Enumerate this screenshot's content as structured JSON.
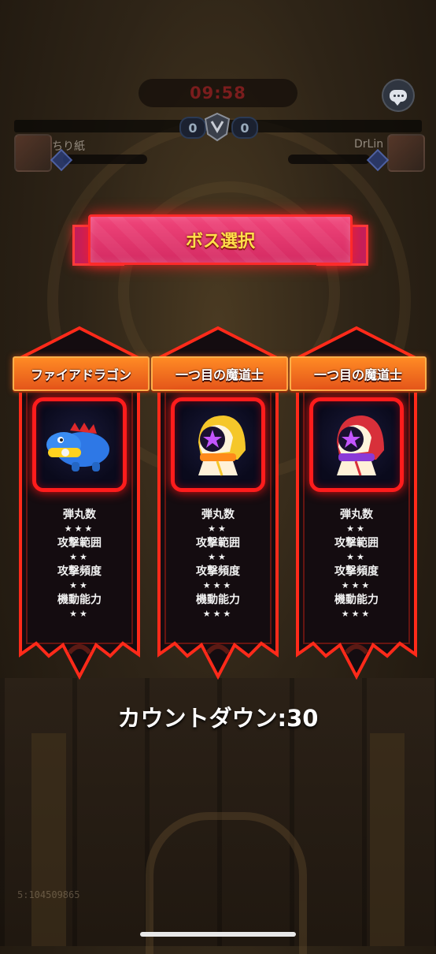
{
  "hud": {
    "timer": "09:58",
    "score_left": "0",
    "score_right": "0",
    "player_left_name": "ちり紙",
    "player_right_name": "DrLin"
  },
  "title": "ボス選択",
  "bosses": [
    {
      "name": "ファイアドラゴン",
      "icon": "blue-dragon-icon",
      "stats": [
        {
          "label": "弾丸数",
          "stars": "★★★"
        },
        {
          "label": "攻撃範囲",
          "stars": "★★"
        },
        {
          "label": "攻撃頻度",
          "stars": "★★"
        },
        {
          "label": "機動能力",
          "stars": "★★"
        }
      ]
    },
    {
      "name": "一つ目の魔道士",
      "icon": "yellow-hooded-mage-icon",
      "stats": [
        {
          "label": "弾丸数",
          "stars": "★★"
        },
        {
          "label": "攻撃範囲",
          "stars": "★★"
        },
        {
          "label": "攻撃頻度",
          "stars": "★★★"
        },
        {
          "label": "機動能力",
          "stars": "★★★"
        }
      ]
    },
    {
      "name": "一つ目の魔道士",
      "icon": "red-hooded-mage-icon",
      "stats": [
        {
          "label": "弾丸数",
          "stars": "★★"
        },
        {
          "label": "攻撃範囲",
          "stars": "★★"
        },
        {
          "label": "攻撃頻度",
          "stars": "★★★"
        },
        {
          "label": "機動能力",
          "stars": "★★★"
        }
      ]
    }
  ],
  "countdown": "カウントダウン:30",
  "footer_id": "5:104509865",
  "colors": {
    "card_border": "#ff2a1a",
    "card_fill": "#120c10",
    "banner": "#e23a6e",
    "title_text": "#ffe04a",
    "name_plate": "#f26a1e"
  }
}
